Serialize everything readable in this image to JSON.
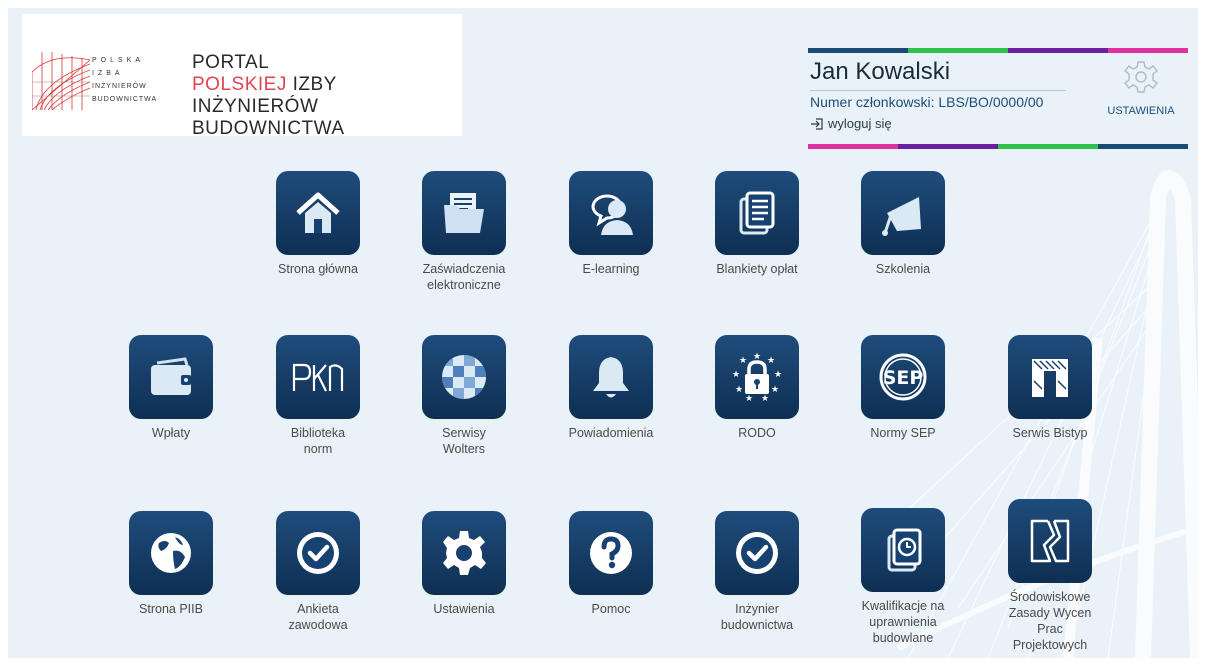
{
  "logo": {
    "small_lines": [
      "POLSKA",
      "IZBA",
      "INŻYNIERÓW",
      "BUDOWNICTWA"
    ],
    "line1": "PORTAL",
    "line2_red": "POLSKIEJ",
    "line2_rest": " IZBY INŻYNIERÓW",
    "line3": "BUDOWNICTWA"
  },
  "user": {
    "name": "Jan Kowalski",
    "member_number": "Numer członkowski: LBS/BO/0000/00",
    "logout_label": "wyloguj się",
    "settings_label": "USTAWIENIA"
  },
  "accent_colors": {
    "navy": "#1b4a74",
    "green": "#2fc24b",
    "purple": "#6a1fa0",
    "magenta": "#e0319f",
    "red": "#e0454f"
  },
  "tiles": [
    {
      "label": "Strona główna",
      "icon": "home-icon"
    },
    {
      "label": "Zaświadczenia\nelektroniczne",
      "icon": "folder-documents-icon"
    },
    {
      "label": "E-learning",
      "icon": "user-chat-icon"
    },
    {
      "label": "Blankiety opłat",
      "icon": "documents-icon"
    },
    {
      "label": "Szkolenia",
      "icon": "graduation-cap-icon"
    },
    {
      "label": "Wpłaty",
      "icon": "wallet-icon"
    },
    {
      "label": "Biblioteka\nnorm",
      "icon": "pkn-logo-icon"
    },
    {
      "label": "Serwisy\nWolters",
      "icon": "wolters-sphere-icon"
    },
    {
      "label": "Powiadomienia",
      "icon": "bell-icon"
    },
    {
      "label": "RODO",
      "icon": "padlock-stars-icon"
    },
    {
      "label": "Normy SEP",
      "icon": "sep-logo-icon"
    },
    {
      "label": "Serwis Bistyp",
      "icon": "bistyp-logo-icon"
    },
    {
      "label": "Strona PIIB",
      "icon": "globe-icon"
    },
    {
      "label": "Ankieta\nzawodowa",
      "icon": "check-circle-icon"
    },
    {
      "label": "Ustawienia",
      "icon": "gear-icon"
    },
    {
      "label": "Pomoc",
      "icon": "question-icon"
    },
    {
      "label": "Inżynier\nbudownictwa",
      "icon": "check-circle-icon"
    },
    {
      "label": "Kwalifikacje na\nuprawnienia\nbudowlane",
      "icon": "clock-documents-icon"
    },
    {
      "label": "Środowiskowe\nZasady Wycen\nPrac\nProjektowych",
      "icon": "broken-frame-icon"
    }
  ]
}
